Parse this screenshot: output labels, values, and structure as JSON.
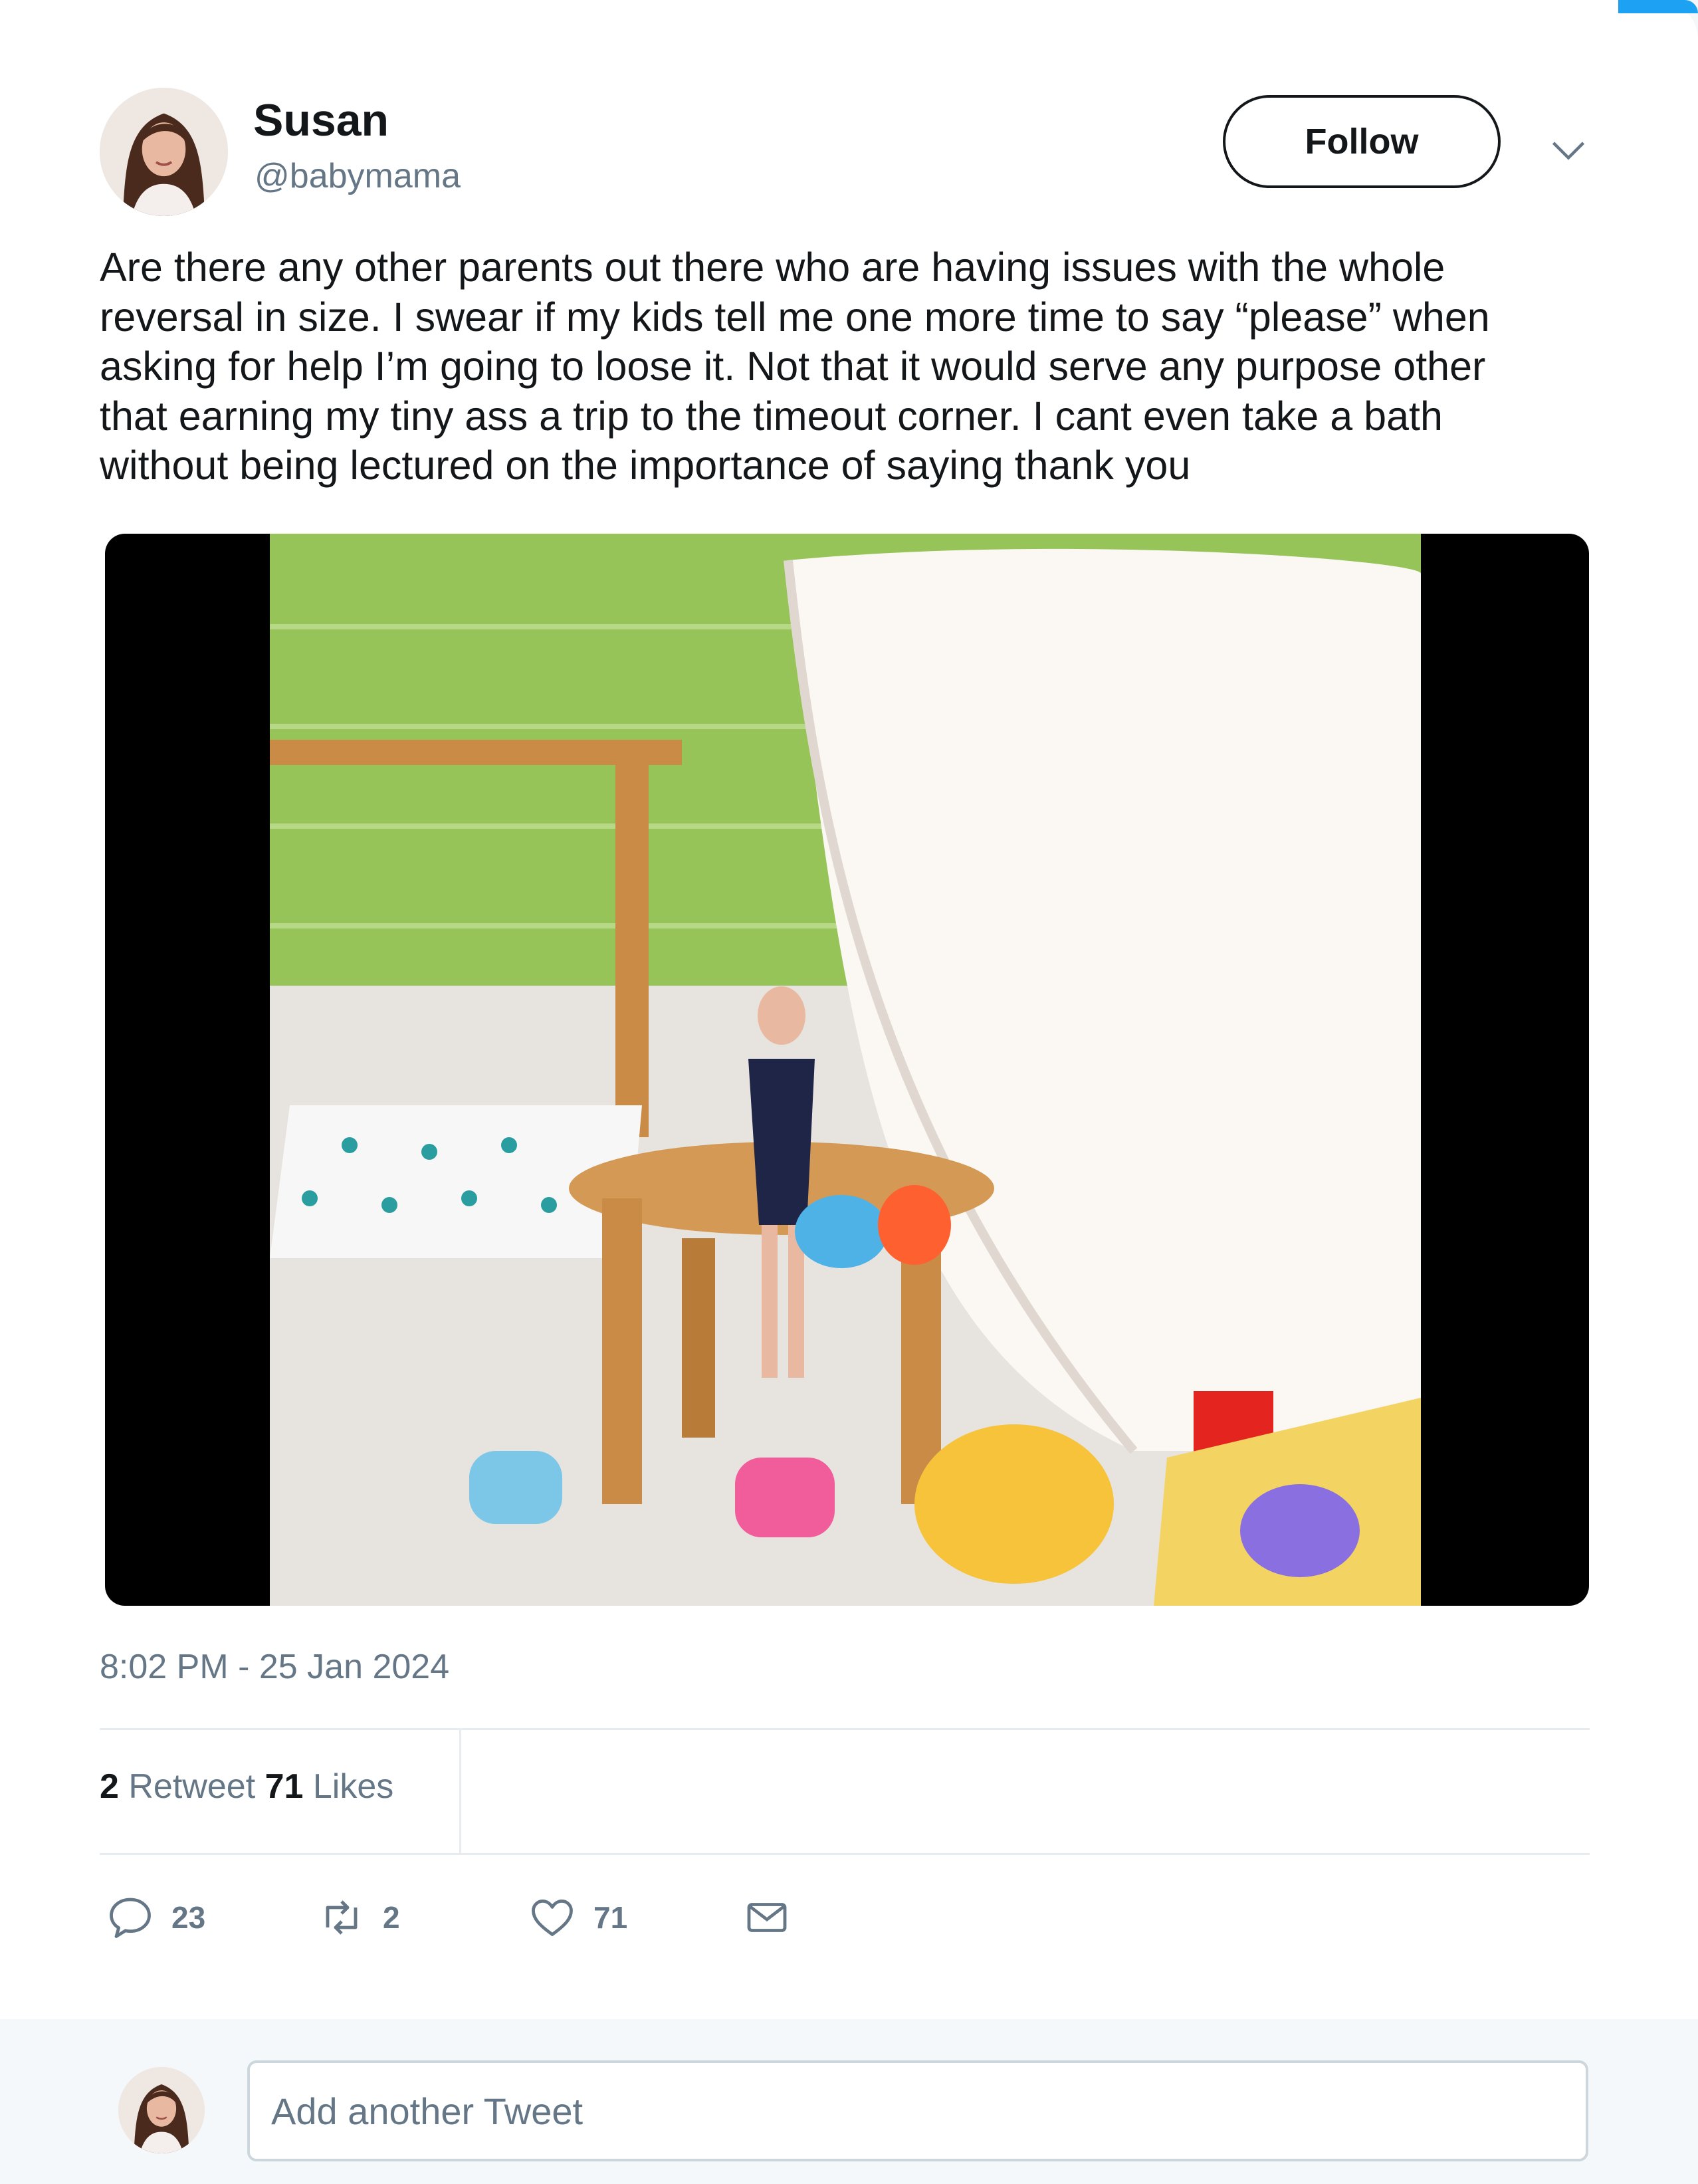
{
  "user": {
    "name": "Susan",
    "handle": "@babymama"
  },
  "follow_label": "Follow",
  "tweet": {
    "text": "Are there any other parents out there who are having issues with the whole\nreversal in size. I swear if my kids tell me one more time to say “please” when\nasking for help I’m going to loose it. Not that it would serve any purpose other\nthat earning my tiny ass a trip to the timeout corner. I cant even take a bath\nwithout being lectured on the importance of saying thank you",
    "timestamp": "8:02 PM - 25 Jan 2024"
  },
  "stats": {
    "retweets": "2",
    "retweets_label": "Retweet",
    "likes": "71",
    "likes_label": "Likes"
  },
  "actions": {
    "reply_count": "23",
    "retweet_count": "2",
    "like_count": "71"
  },
  "reply": {
    "placeholder": "Add another Tweet"
  },
  "icons": {
    "chevron": "chevron-down-icon",
    "reply": "reply-icon",
    "retweet": "retweet-icon",
    "like": "heart-icon",
    "dm": "envelope-icon"
  },
  "colors": {
    "text": "#14171a",
    "muted": "#657786",
    "border": "#e6ecf0",
    "page_bg": "#f5f8fa",
    "accent": "#1da1f2"
  }
}
